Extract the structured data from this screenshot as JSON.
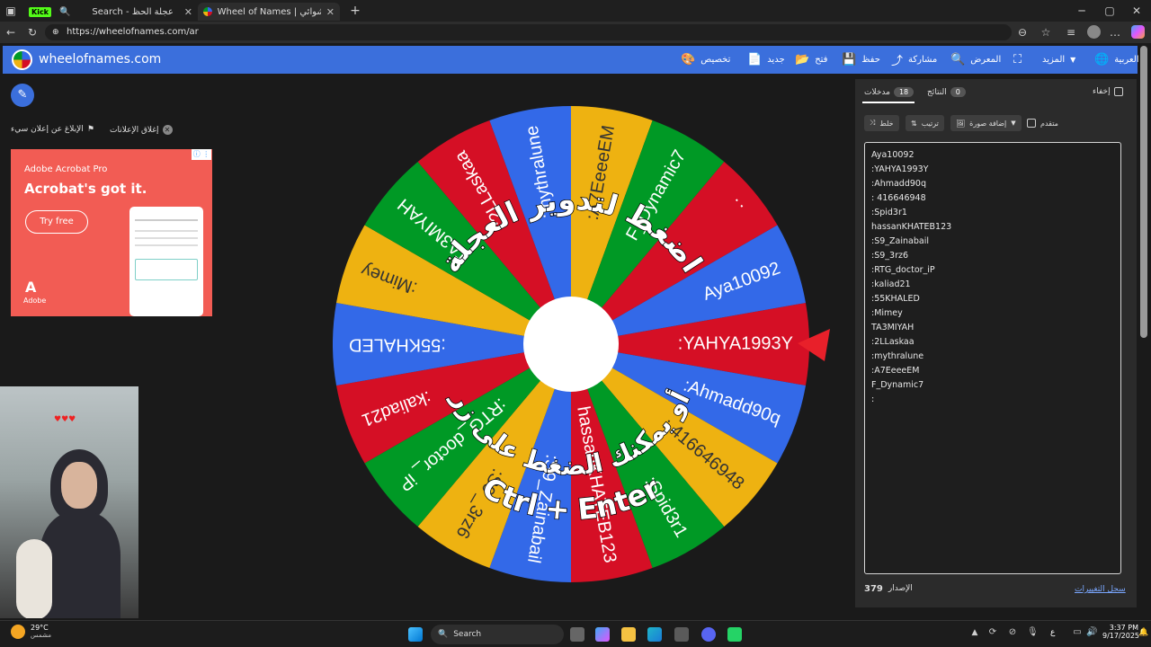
{
  "browser": {
    "tabs": [
      {
        "label": "Kick"
      },
      {
        "label": "Search - عجلة الحظ"
      },
      {
        "label": "Wheel of Names | الاسم العشوائي"
      }
    ],
    "url": "https://wheelofnames.com/ar"
  },
  "header": {
    "site_name": "wheelofnames.com",
    "nav": {
      "customize": "تخصيص",
      "new": "جديد",
      "open": "فتح",
      "save": "حفظ",
      "share": "مشاركة",
      "gallery": "المعرض",
      "more": "المزيد",
      "language": "العربية"
    }
  },
  "ad_bar": {
    "report": "الإبلاغ عن إعلان سيء",
    "close": "إغلاق الإعلانات"
  },
  "ad": {
    "brand_line": "Adobe Acrobat Pro",
    "headline": "Acrobat's got it.",
    "cta": "Try free",
    "logo_text": "Adobe"
  },
  "panel": {
    "entries_tab": "مدخلات",
    "entries_count": "18",
    "results_tab": "النتائج",
    "results_count": "0",
    "hide": "إخفاء",
    "shuffle": "خلط",
    "sort": "ترتيب",
    "add_image": "إضافة صورة",
    "advanced": "متقدم",
    "entries": [
      "Aya10092",
      ":YAHYA1993Y",
      ":Ahmadd90q",
      ": 416646948",
      ":Spid3r1",
      "hassanKHATEB123",
      ":S9_Zainabail",
      ":S9_3rz6",
      ":RTG_doctor_iP",
      ":kaliad21",
      ":55KHALED",
      ":Mimey",
      "TA3MIYAH",
      ":2LLaskaa",
      ":mythralune",
      ":A7EeeeEM",
      "F_Dynamic7",
      ":"
    ],
    "version_label": "الإصدار",
    "version_number": "379",
    "changelog": "سجل التغييرات"
  },
  "wheel": {
    "colors": [
      "#3369e8",
      "#d50f25",
      "#eeb211",
      "#009925"
    ],
    "segments": [
      ":YAHYA1993Y",
      ":Ahmadd90q",
      ": 416646948",
      ":Spid3r1",
      "hassanKHATEB123",
      ":S9_Zainabail",
      ":S9 _3rz6",
      ":RTG_doctor_ iP",
      ":kaliad21",
      ":55KHALED",
      ":Mimey",
      "TA3MIYAH",
      ":2LLaskaa",
      ":mythralune",
      ":A7EeeeEM",
      "F_Dynamic7",
      ":",
      "Aya10092"
    ],
    "overlay_top": "اضغط لتدوير العجلة",
    "overlay_bottom_1": "أو يمكنك الضغط على زر",
    "overlay_bottom_2": "Ctrl + Enter"
  },
  "taskbar": {
    "temp": "29°C",
    "weather": "مشمس",
    "search": "Search",
    "time": "3:37 PM",
    "date": "9/17/2025",
    "lang": "ع"
  }
}
